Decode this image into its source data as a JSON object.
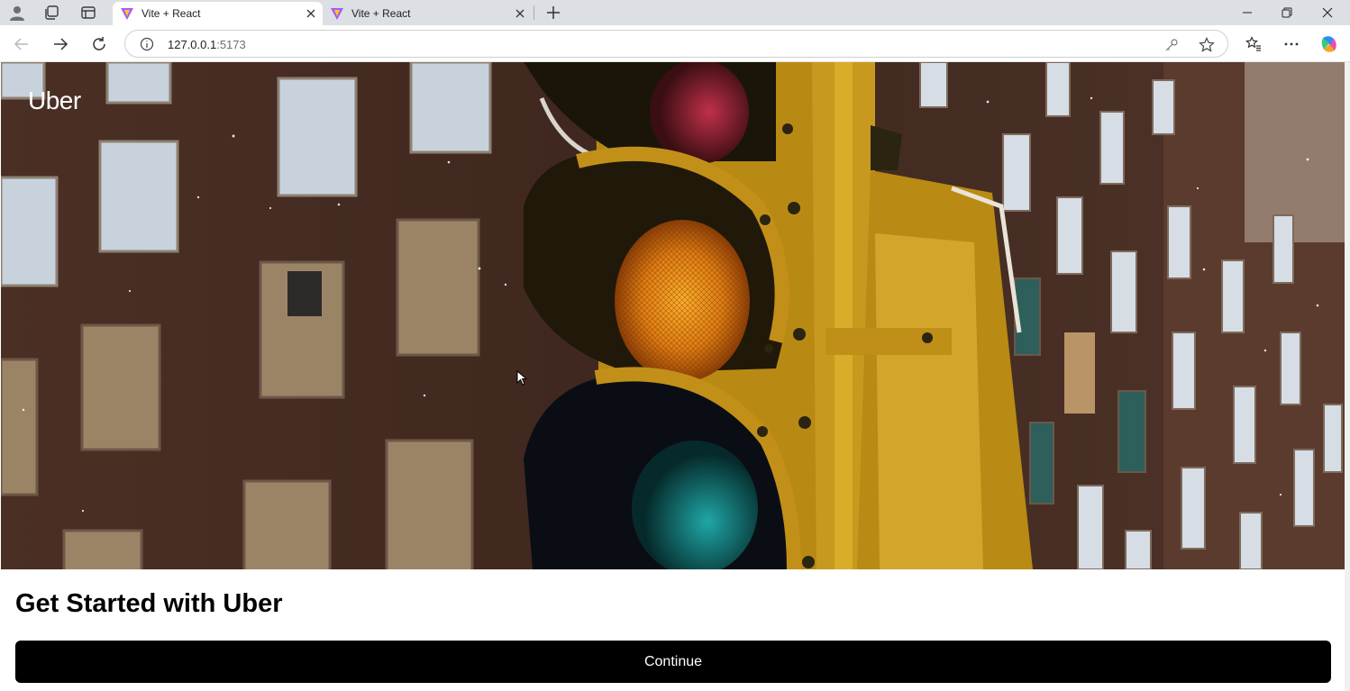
{
  "browser": {
    "tabs": [
      {
        "title": "Vite + React",
        "active": true
      },
      {
        "title": "Vite + React",
        "active": false
      }
    ],
    "address": {
      "host": "127.0.0.1",
      "port": ":5173"
    },
    "icons": [
      "profile-icon",
      "workspaces-icon",
      "tab-actions-icon",
      "vite-icon",
      "close-icon",
      "new-tab-icon",
      "minimize-icon",
      "restore-icon",
      "back-icon",
      "forward-icon",
      "refresh-icon",
      "site-info-icon",
      "key-icon",
      "star-icon",
      "favorites-icon",
      "more-icon",
      "copilot-icon"
    ],
    "accent": "#0f6cbd"
  },
  "page": {
    "brand": "Uber",
    "heading": "Get Started with Uber",
    "continue_label": "Continue",
    "hero_image": "traffic-light-photo",
    "colors": {
      "button_bg": "#000000",
      "button_text": "#ffffff",
      "heading": "#000000"
    }
  }
}
